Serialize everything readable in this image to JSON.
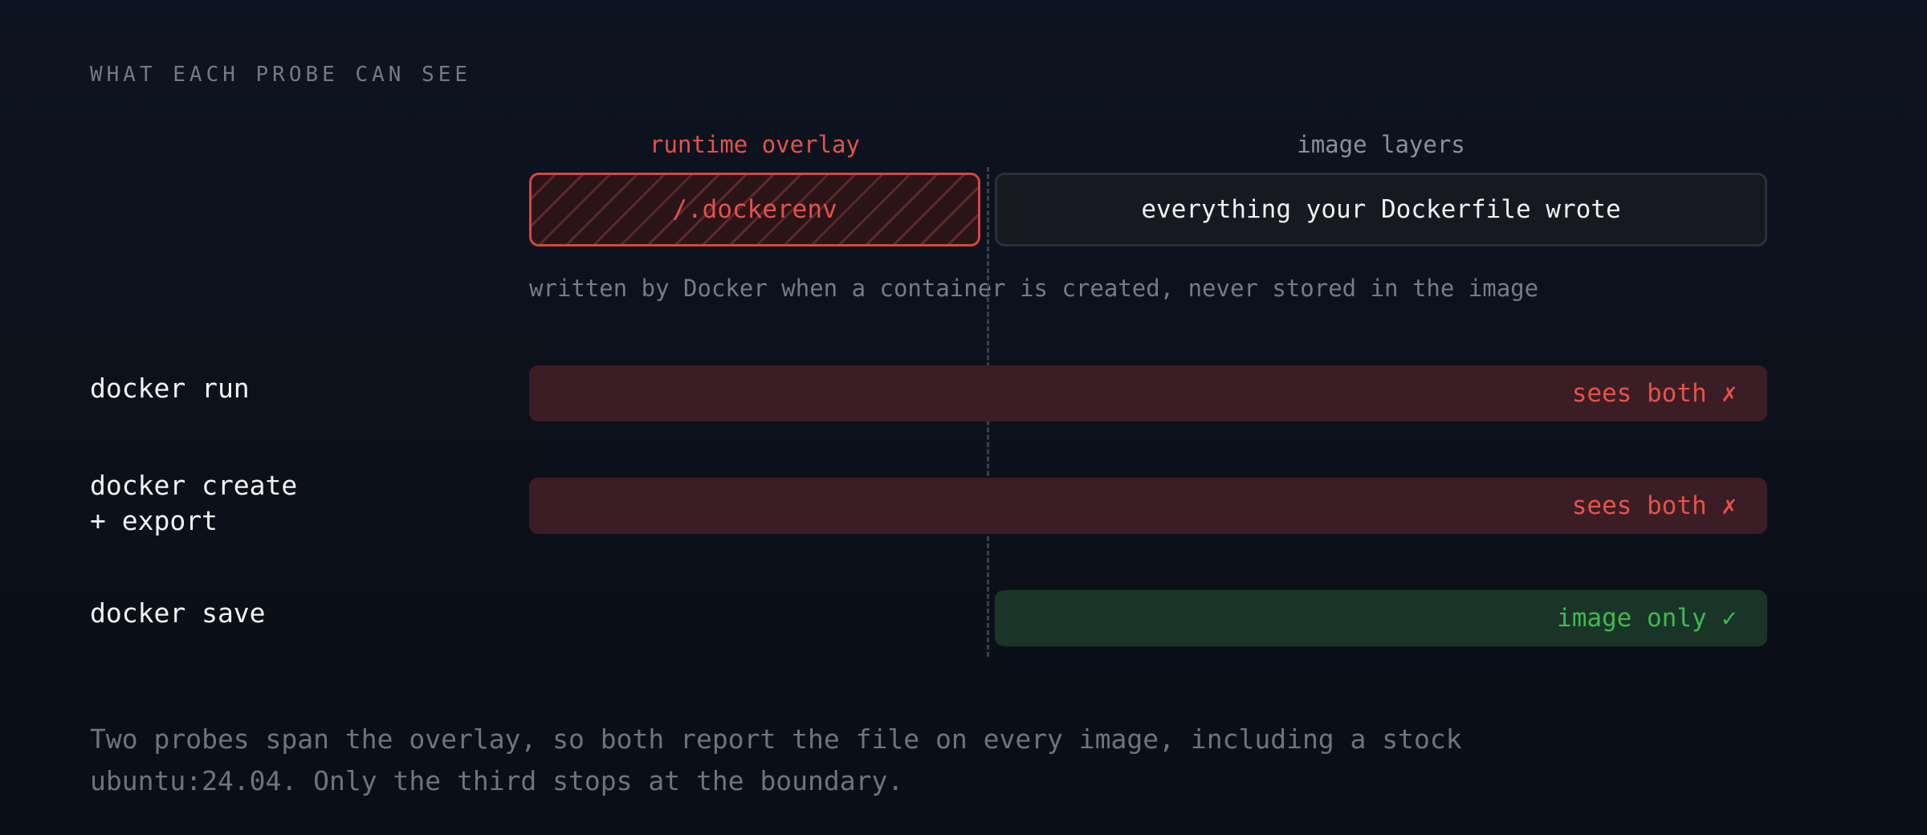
{
  "heading": "WHAT EACH PROBE CAN SEE",
  "columns": {
    "overlay_label": "runtime overlay",
    "layers_label": "image layers"
  },
  "boxes": {
    "overlay_text": "/.dockerenv",
    "layers_text": "everything your Dockerfile wrote"
  },
  "caption": "written by Docker when a container is created, never stored in the image",
  "probes": [
    {
      "label_line1": "docker run",
      "label_line2": "",
      "result": "sees both ✗",
      "spans": "overlay+layers",
      "status": "bad"
    },
    {
      "label_line1": "docker create",
      "label_line2": "+ export",
      "result": "sees both ✗",
      "spans": "overlay+layers",
      "status": "bad"
    },
    {
      "label_line1": "docker save",
      "label_line2": "",
      "result": "image only ✓",
      "spans": "layers",
      "status": "good"
    }
  ],
  "footer": {
    "line1": "Two probes span the overlay, so both report the file on every image, including a stock",
    "line2": "ubuntu:24.04. Only the third stops at the boundary."
  },
  "colors": {
    "bad": "#e5524a",
    "good": "#3fb950",
    "bad_bar": "#3b1d25",
    "good_bar": "#1a3527"
  }
}
